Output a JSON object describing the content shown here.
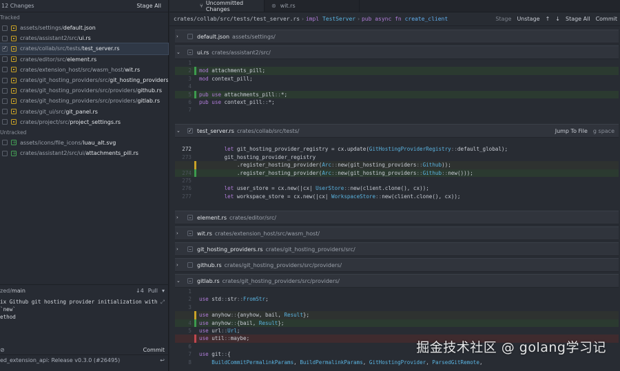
{
  "left": {
    "changes_count": "12 Changes",
    "stage_all": "Stage All",
    "tracked_label": "Tracked",
    "untracked_label": "Untracked",
    "tracked": [
      {
        "dir": "assets/settings/",
        "name": "default.json",
        "checked": false
      },
      {
        "dir": "crates/assistant2/src/",
        "name": "ui.rs",
        "checked": false
      },
      {
        "dir": "crates/collab/src/tests/",
        "name": "test_server.rs",
        "checked": true
      },
      {
        "dir": "crates/editor/src/",
        "name": "element.rs",
        "checked": false
      },
      {
        "dir": "crates/extension_host/src/wasm_host/",
        "name": "wit.rs",
        "checked": false
      },
      {
        "dir": "crates/git_hosting_providers/src/",
        "name": "git_hosting_providers.rs",
        "checked": false
      },
      {
        "dir": "crates/git_hosting_providers/src/providers/",
        "name": "github.rs",
        "checked": false
      },
      {
        "dir": "crates/git_hosting_providers/src/providers/",
        "name": "gitlab.rs",
        "checked": false
      },
      {
        "dir": "crates/git_ui/src/",
        "name": "git_panel.rs",
        "checked": false
      },
      {
        "dir": "crates/project/src/",
        "name": "project_settings.rs",
        "checked": false
      }
    ],
    "untracked": [
      {
        "dir": "assets/icons/file_icons/",
        "name": "luau_alt.svg"
      },
      {
        "dir": "crates/assistant2/src/ui/",
        "name": "attachments_pill.rs"
      }
    ],
    "branch_prefix": "zed/",
    "branch_name": "main",
    "pull_count": "↓4",
    "pull_label": "Pull",
    "commit_message": "ix Github git hosting provider initialization with `new`\nethod",
    "commit_button": "Commit",
    "last_commit": "ed_extension_api: Release v0.3.0 (#26495)"
  },
  "tabs": [
    {
      "label": "Uncommitted Changes",
      "active": true
    },
    {
      "label": "wit.rs",
      "active": false
    }
  ],
  "crumbs": {
    "path": "crates/collab/src/tests/test_server.rs",
    "impl_kw": "impl",
    "impl_type": "TestServer",
    "fn_kw": "pub async fn",
    "fn_name": "create_client"
  },
  "toolbar": {
    "stage": "Stage",
    "unstage": "Unstage",
    "up": "↑",
    "down": "↓",
    "stage_all": "Stage All",
    "commit": "Commit"
  },
  "files": [
    {
      "name": "default.json",
      "path": "assets/settings/",
      "expanded": false
    },
    {
      "name": "ui.rs",
      "path": "crates/assistant2/src/",
      "expanded": true
    },
    {
      "name": "test_server.rs",
      "path": "crates/collab/src/tests/",
      "expanded": true,
      "checked": true,
      "jump": "Jump To File",
      "key": "g  space"
    },
    {
      "name": "element.rs",
      "path": "crates/editor/src/",
      "expanded": true
    },
    {
      "name": "wit.rs",
      "path": "crates/extension_host/src/wasm_host/",
      "expanded": true
    },
    {
      "name": "git_hosting_providers.rs",
      "path": "crates/git_hosting_providers/src/",
      "expanded": true
    },
    {
      "name": "github.rs",
      "path": "crates/git_hosting_providers/src/providers/",
      "expanded": false
    },
    {
      "name": "gitlab.rs",
      "path": "crates/git_hosting_providers/src/providers/",
      "expanded": true
    }
  ],
  "hunks": {
    "ui": [
      {
        "n": "1",
        "type": "ctx",
        "code": ""
      },
      {
        "n": "2",
        "type": "add",
        "code": "mod attachments_pill;"
      },
      {
        "n": "3",
        "type": "ctx",
        "code": "mod context_pill;"
      },
      {
        "n": "4",
        "type": "ctx",
        "code": ""
      },
      {
        "n": "5",
        "type": "add",
        "code": "pub use attachments_pill::*;"
      },
      {
        "n": "6",
        "type": "ctx",
        "code": "pub use context_pill::*;"
      },
      {
        "n": "7",
        "type": "ctx",
        "code": ""
      }
    ],
    "test_server": [
      {
        "n": "",
        "type": "ctx",
        "code": ""
      },
      {
        "n": "272",
        "type": "ctx",
        "cur": true,
        "code": "        let git_hosting_provider_registry = cx.update(GitHostingProviderRegistry::default_global);"
      },
      {
        "n": "273",
        "type": "ctx",
        "code": "        git_hosting_provider_registry"
      },
      {
        "n": "",
        "type": "mod",
        "code": "            .register_hosting_provider(Arc::new(git_hosting_providers::Github));"
      },
      {
        "n": "274",
        "type": "add",
        "code": "            .register_hosting_provider(Arc::new(git_hosting_providers::Github::new()));"
      },
      {
        "n": "275",
        "type": "ctx",
        "code": ""
      },
      {
        "n": "276",
        "type": "ctx",
        "code": "        let user_store = cx.new(|cx| UserStore::new(client.clone(), cx));"
      },
      {
        "n": "277",
        "type": "ctx",
        "code": "        let workspace_store = cx.new(|cx| WorkspaceStore::new(client.clone(), cx));"
      }
    ],
    "gitlab": [
      {
        "n": "1",
        "type": "ctx",
        "code": ""
      },
      {
        "n": "2",
        "type": "ctx",
        "code": "use std::str::FromStr;"
      },
      {
        "n": "3",
        "type": "ctx",
        "code": ""
      },
      {
        "n": "",
        "type": "mod",
        "code": "use anyhow::{anyhow, bail, Result};"
      },
      {
        "n": "4",
        "type": "add",
        "code": "use anyhow::{bail, Result};"
      },
      {
        "n": "5",
        "type": "ctx",
        "code": "use url::Url;"
      },
      {
        "n": "",
        "type": "del",
        "code": "use util::maybe;"
      },
      {
        "n": "6",
        "type": "ctx",
        "code": ""
      },
      {
        "n": "7",
        "type": "ctx",
        "code": "use git::{"
      },
      {
        "n": "8",
        "type": "ctx",
        "code": "    BuildCommitPermalinkParams, BuildPermalinkParams, GitHostingProvider, ParsedGitRemote,"
      }
    ]
  },
  "watermark": "掘金技术社区 @ golang学习记"
}
